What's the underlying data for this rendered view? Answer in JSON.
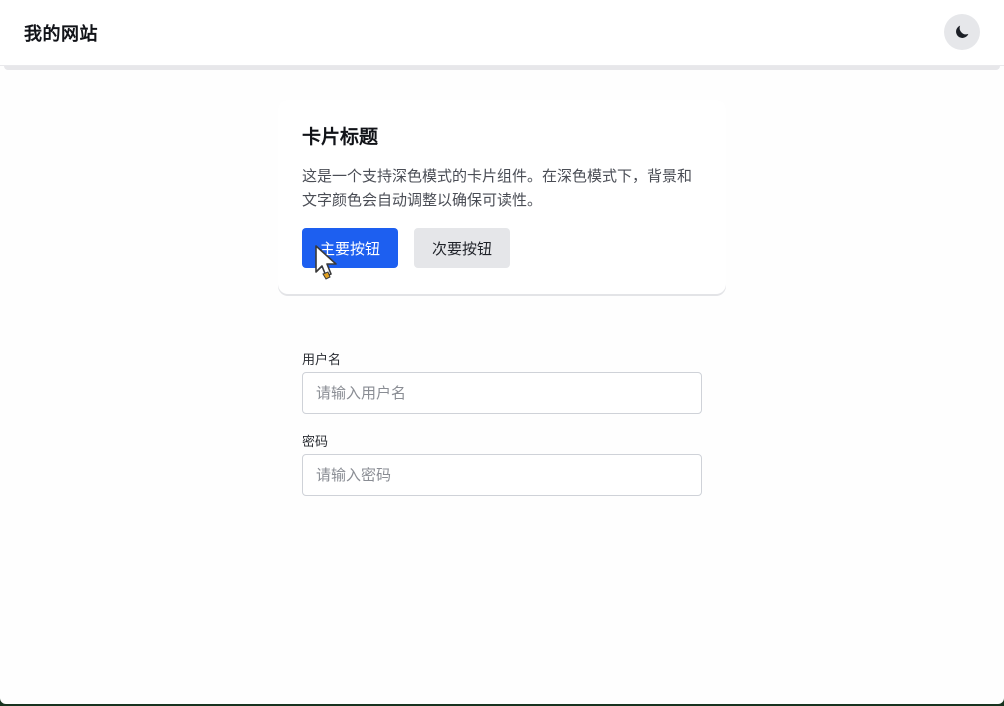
{
  "header": {
    "title": "我的网站",
    "theme_toggle_icon": "moon-icon"
  },
  "card": {
    "title": "卡片标题",
    "description": "这是一个支持深色模式的卡片组件。在深色模式下，背景和文字颜色会自动调整以确保可读性。",
    "primary_button": "主要按钮",
    "secondary_button": "次要按钮"
  },
  "form": {
    "username_label": "用户名",
    "username_placeholder": "请输入用户名",
    "username_value": "",
    "password_label": "密码",
    "password_placeholder": "请输入密码",
    "password_value": ""
  },
  "colors": {
    "primary": "#1d5ff0",
    "secondary": "#e5e6e9",
    "text": "#111318"
  }
}
